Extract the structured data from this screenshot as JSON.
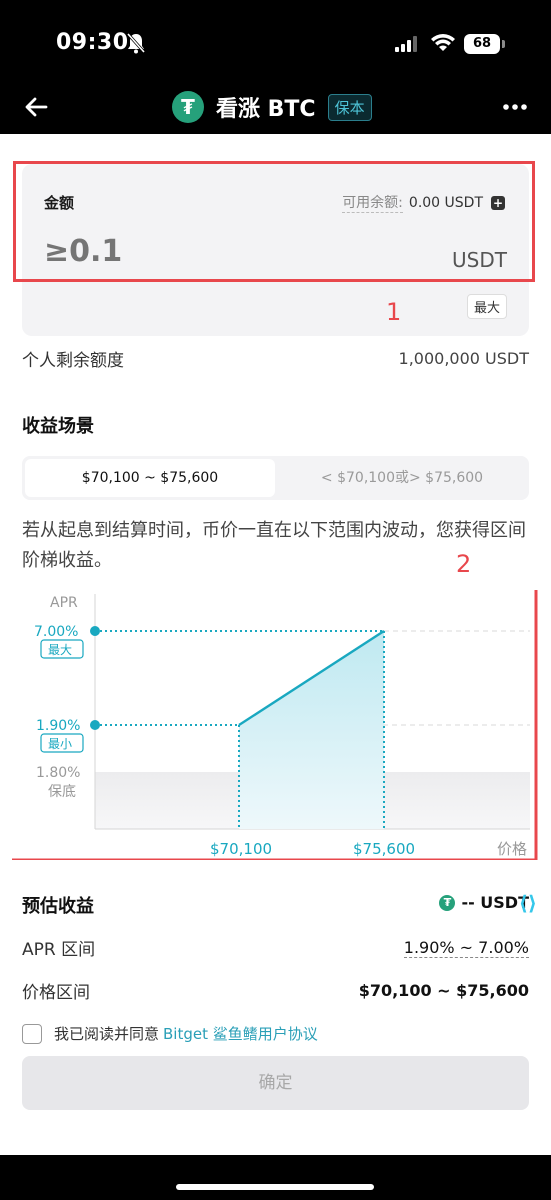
{
  "status_bar": {
    "time": "09:30",
    "battery": "68"
  },
  "nav": {
    "title": "看涨 BTC",
    "tag": "保本",
    "logo_glyph": "₮"
  },
  "amount": {
    "label": "金额",
    "available_label": "可用余额:",
    "available_value": "0.00 USDT",
    "placeholder": "≥0.1",
    "unit": "USDT",
    "max_label": "最大"
  },
  "annotations": {
    "box1": "1",
    "box2": "2"
  },
  "quota": {
    "label": "个人剩余额度",
    "value": "1,000,000 USDT"
  },
  "scenario": {
    "title": "收益场景",
    "options": [
      "$70,100 ~ $75,600",
      "< $70,100或> $75,600"
    ],
    "selected": 0,
    "description": "若从起息到结算时间，币价一直在以下范围内波动，您获得区间阶梯收益。"
  },
  "chart_data": {
    "type": "line",
    "ylabel": "APR",
    "xlabel": "价格",
    "max_label": "最大",
    "min_label": "最小",
    "floor_label": "保底",
    "floor_apr": "1.80%",
    "min_apr": "1.90%",
    "max_apr": "7.00%",
    "x_ticks": [
      "$70,100",
      "$75,600"
    ],
    "points": [
      {
        "x": 70100,
        "y": 1.9
      },
      {
        "x": 75600,
        "y": 7.0
      }
    ]
  },
  "estimate": {
    "title": "预估收益",
    "value": "-- USDT",
    "apr_label": "APR 区间",
    "apr_value": "1.90% ~ 7.00%",
    "price_label": "价格区间",
    "price_value": "$70,100 ~ $75,600"
  },
  "agreement": {
    "text": "我已阅读并同意",
    "link": "Bitget 鲨鱼鳍用户协议"
  },
  "confirm_label": "确定",
  "colors": {
    "accent": "#19a8c0",
    "annotation": "#e8474c",
    "tether": "#26a17b"
  }
}
